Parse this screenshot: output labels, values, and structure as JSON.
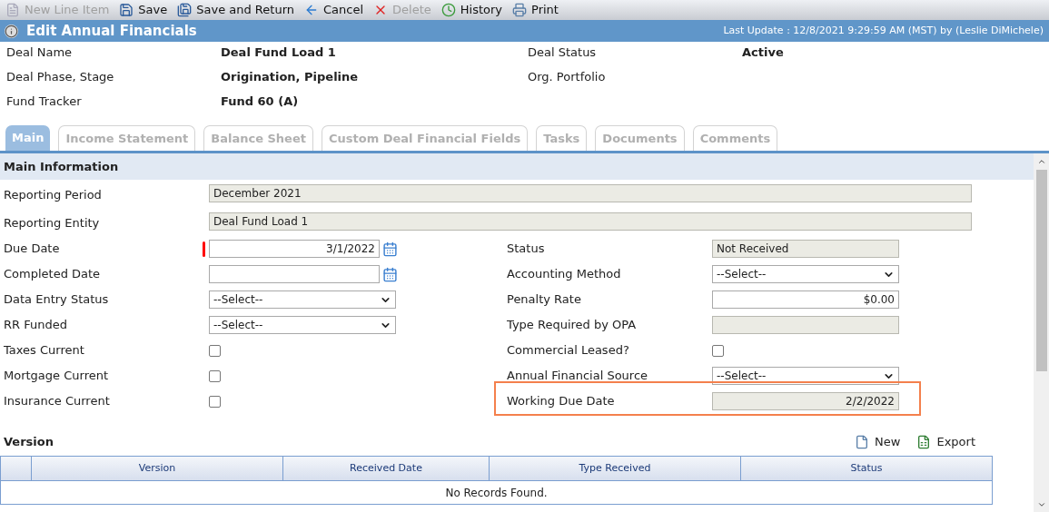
{
  "toolbar": [
    {
      "label": "New Line Item",
      "disabled": true
    },
    {
      "label": "Save",
      "disabled": false
    },
    {
      "label": "Save and Return",
      "disabled": false
    },
    {
      "label": "Cancel",
      "disabled": false
    },
    {
      "label": "Delete",
      "disabled": true
    },
    {
      "label": "History",
      "disabled": false
    },
    {
      "label": "Print",
      "disabled": false
    }
  ],
  "title_bar": {
    "title": "Edit Annual Financials",
    "last_update": "Last Update : 12/8/2021 9:29:59 AM (MST) by (Leslie DiMichele)"
  },
  "deal_info": [
    {
      "label": "Deal Name",
      "value": "Deal Fund Load 1"
    },
    {
      "label": "Deal Status",
      "value": "Active"
    },
    {
      "label": "Deal Phase, Stage",
      "value": "Origination, Pipeline"
    },
    {
      "label": "Org. Portfolio"
    },
    {
      "label": "Fund Tracker",
      "value": "Fund 60 (A)"
    }
  ],
  "tabs": [
    {
      "label": "Main",
      "selected": true
    },
    {
      "label": "Income Statement",
      "selected": false
    },
    {
      "label": "Balance Sheet",
      "selected": false
    },
    {
      "label": "Custom Deal Financial Fields",
      "selected": false
    },
    {
      "label": "Tasks",
      "selected": false
    },
    {
      "label": "Documents",
      "selected": false
    },
    {
      "label": "Comments",
      "selected": false
    }
  ],
  "main_information": {
    "title": "Main Information",
    "wide_fields": [
      {
        "label": "Reporting Period",
        "value": "December 2021"
      },
      {
        "label": "Reporting Entity",
        "value": "Deal Fund Load 1"
      }
    ],
    "rows": [
      {
        "left": {
          "label": "Due Date",
          "kind": "date",
          "value": "3/1/2022",
          "required": true
        },
        "right": {
          "label": "Status",
          "kind": "readonly",
          "value": "Not Received"
        }
      },
      {
        "left": {
          "label": "Completed Date",
          "kind": "date"
        },
        "right": {
          "label": "Accounting Method",
          "kind": "select",
          "value": "--Select--"
        }
      },
      {
        "left": {
          "label": "Data Entry Status",
          "kind": "select",
          "value": "--Select--"
        },
        "right": {
          "label": "Penalty Rate",
          "kind": "text",
          "value": "$0.00"
        }
      },
      {
        "left": {
          "label": "RR Funded",
          "kind": "select",
          "value": "--Select--"
        },
        "right": {
          "label": "Type Required by OPA",
          "kind": "readonly"
        }
      },
      {
        "left": {
          "label": "Taxes Current",
          "kind": "checkbox",
          "checked": false
        },
        "right": {
          "label": "Commercial Leased?",
          "kind": "checkbox",
          "checked": false
        }
      },
      {
        "left": {
          "label": "Mortgage Current",
          "kind": "checkbox",
          "checked": false
        },
        "right": {
          "label": "Annual Financial Source",
          "kind": "select",
          "value": "--Select--"
        }
      },
      {
        "left": {
          "label": "Insurance Current",
          "kind": "checkbox",
          "checked": false
        },
        "right": {
          "label": "Working Due Date",
          "kind": "readonly",
          "value": "2/2/2022",
          "highlighted": true
        }
      }
    ]
  },
  "version": {
    "title": "Version",
    "actions": [
      "New",
      "Export"
    ],
    "columns": [
      "Version",
      "Received Date",
      "Type Received",
      "Status"
    ],
    "empty_message": "No Records Found."
  }
}
